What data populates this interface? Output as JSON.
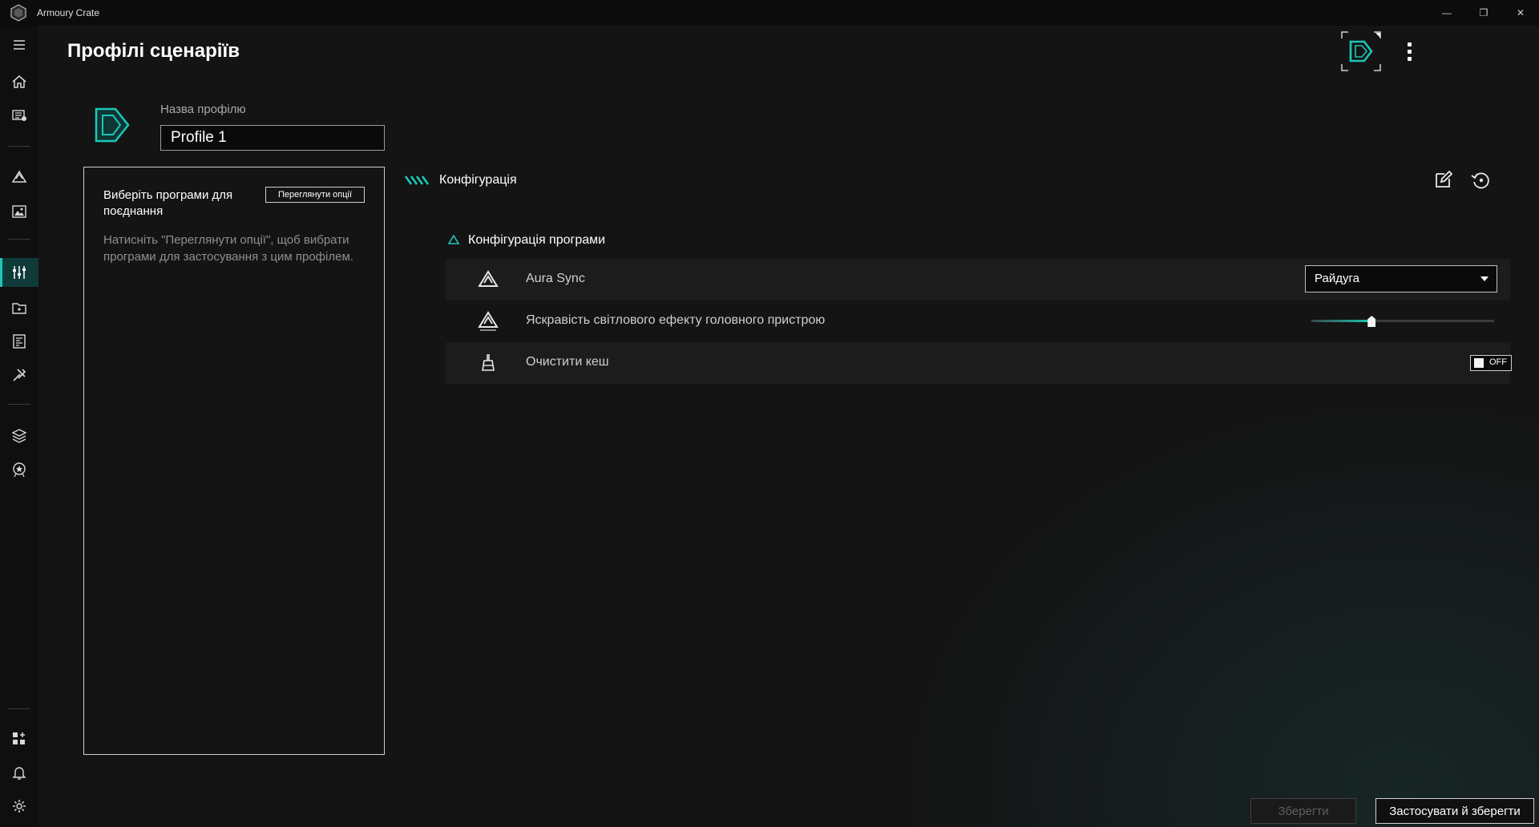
{
  "window": {
    "title": "Armoury Crate",
    "minimize_glyph": "—",
    "restore_glyph": "❐",
    "close_glyph": "✕"
  },
  "sidebar": {
    "items": [
      {
        "icon": "menu-icon"
      },
      {
        "icon": "home-icon"
      },
      {
        "icon": "device-icon"
      },
      {
        "icon": "aura-icon"
      },
      {
        "icon": "wallpaper-icon"
      },
      {
        "icon": "scenario-profiles-icon",
        "active": true
      },
      {
        "icon": "game-library-icon"
      },
      {
        "icon": "armoury-icon"
      },
      {
        "icon": "tools-icon"
      },
      {
        "icon": "layers-icon"
      },
      {
        "icon": "member-icon"
      },
      {
        "icon": "apps-add-icon"
      },
      {
        "icon": "notification-icon"
      },
      {
        "icon": "settings-icon"
      }
    ]
  },
  "header": {
    "title": "Профілі сценаріїв"
  },
  "profile": {
    "name_label": "Назва профілю",
    "name_value": "Profile 1"
  },
  "apps_panel": {
    "title": "Виберіть програми для поєднання",
    "view_options_label": "Переглянути опції",
    "hint": "Натисніть \"Переглянути опції\", щоб вибрати програми для застосування з цим профілем."
  },
  "config": {
    "header": "Конфігурація",
    "section_title": "Конфігурація програми",
    "rows": [
      {
        "icon": "aura-sync-icon",
        "label": "Aura Sync",
        "control": "dropdown",
        "value": "Райдуга"
      },
      {
        "icon": "aura-brightness-icon",
        "label": "Яскравість світлового ефекту головного пристрою",
        "control": "slider",
        "value_fraction": 0.33
      },
      {
        "icon": "broom-icon",
        "label": "Очистити кеш",
        "control": "toggle",
        "value": "OFF"
      }
    ]
  },
  "footer": {
    "save_label": "Зберегти",
    "apply_save_label": "Застосувати й зберегти"
  },
  "colors": {
    "accent": "#1cc7b8",
    "background": "#141414",
    "sidebar": "#0f0f0f"
  }
}
